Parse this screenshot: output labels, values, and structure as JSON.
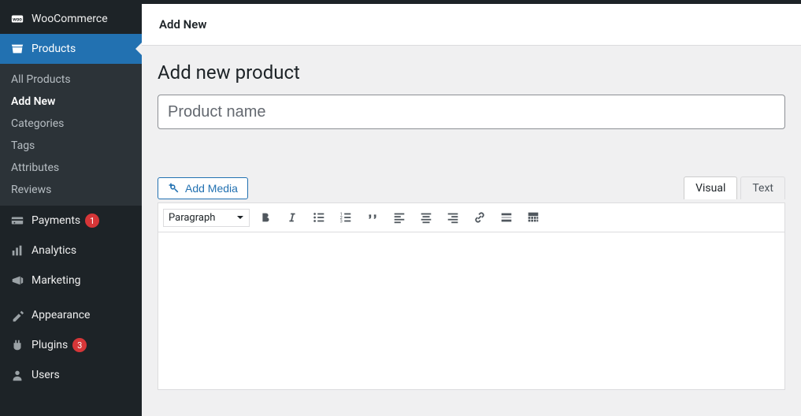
{
  "sidebar": {
    "top": {
      "label": "WooCommerce"
    },
    "current_parent": {
      "label": "Products"
    },
    "submenu": [
      {
        "label": "All Products"
      },
      {
        "label": "Add New"
      },
      {
        "label": "Categories"
      },
      {
        "label": "Tags"
      },
      {
        "label": "Attributes"
      },
      {
        "label": "Reviews"
      }
    ],
    "items_below": [
      {
        "label": "Payments",
        "count": "1"
      },
      {
        "label": "Analytics"
      },
      {
        "label": "Marketing"
      }
    ],
    "items_bottom": [
      {
        "label": "Appearance"
      },
      {
        "label": "Plugins",
        "count": "3"
      },
      {
        "label": "Users"
      }
    ]
  },
  "header": {
    "tab_label": "Add New"
  },
  "page": {
    "title": "Add new product"
  },
  "product": {
    "name_placeholder": "Product name",
    "name_value": ""
  },
  "editor": {
    "add_media_label": "Add Media",
    "tabs": {
      "visual": "Visual",
      "text": "Text"
    },
    "format_select": "Paragraph"
  }
}
